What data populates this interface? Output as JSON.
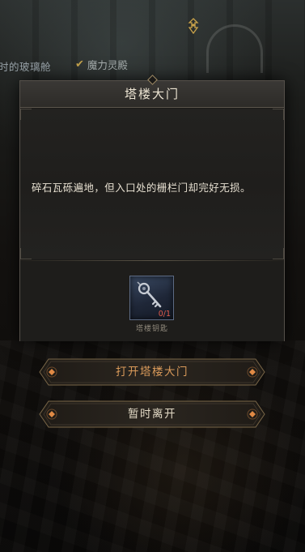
{
  "location": {
    "left_crumb": "时的玻璃舱",
    "right_crumb": "魔力灵殿",
    "check_icon": "check-icon",
    "marker_icon": "map-marker-icon"
  },
  "dialog": {
    "title": "塔楼大门",
    "description": "碎石瓦砾遍地，但入口处的栅栏门却完好无损。",
    "required_item": {
      "name": "塔楼钥匙",
      "count": "0/1",
      "icon": "key-icon"
    }
  },
  "actions": {
    "open_label": "打开塔楼大门",
    "leave_label": "暂时离开"
  },
  "colors": {
    "open_text": "#d99a5a",
    "leave_text": "#e3dac6",
    "count_missing": "#e05a4b",
    "accent_gold": "#c4a24c"
  }
}
